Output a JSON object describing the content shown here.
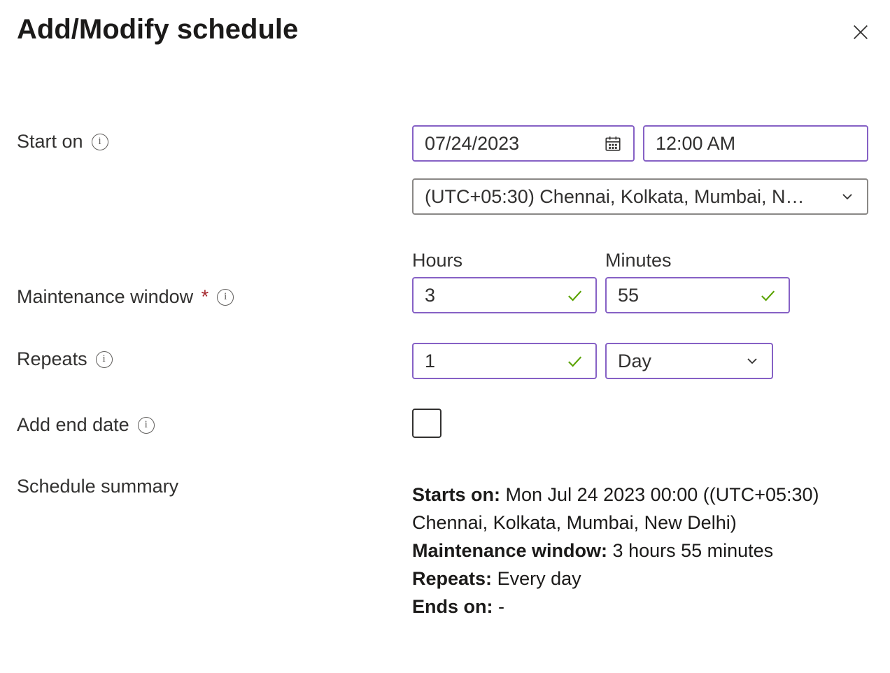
{
  "title": "Add/Modify schedule",
  "labels": {
    "start_on": "Start on",
    "maintenance_window": "Maintenance window",
    "hours": "Hours",
    "minutes": "Minutes",
    "repeats": "Repeats",
    "add_end_date": "Add end date",
    "schedule_summary": "Schedule summary"
  },
  "values": {
    "start_date": "07/24/2023",
    "start_time": "12:00 AM",
    "timezone": "(UTC+05:30) Chennai, Kolkata, Mumbai, N…",
    "hours": "3",
    "minutes": "55",
    "repeat_count": "1",
    "repeat_unit": "Day"
  },
  "summary": {
    "starts_on_label": "Starts on:",
    "starts_on_value": "Mon Jul 24 2023 00:00 ((UTC+05:30) Chennai, Kolkata, Mumbai, New Delhi)",
    "mw_label": "Maintenance window:",
    "mw_value": "3 hours 55 minutes",
    "repeats_label": "Repeats:",
    "repeats_value": "Every day",
    "ends_label": "Ends on:",
    "ends_value": "-"
  }
}
